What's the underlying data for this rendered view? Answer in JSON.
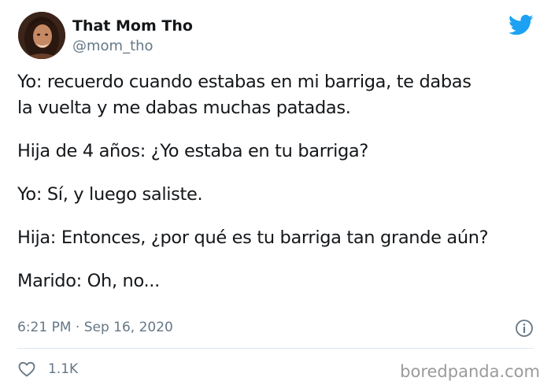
{
  "author": {
    "display_name": "That Mom Tho",
    "handle": "@mom_tho"
  },
  "icons": {
    "brand": "twitter-bird-icon",
    "info": "info-icon",
    "like": "heart-icon"
  },
  "colors": {
    "twitter_blue": "#1da1f2",
    "secondary_text": "#657786",
    "primary_text": "#14171a"
  },
  "tweet": {
    "paragraphs": [
      "Yo: recuerdo cuando estabas en mi barriga, te dabas\nla vuelta y me dabas muchas patadas.",
      "Hija de 4 años: ¿Yo estaba en tu barriga?",
      "Yo: Sí, y luego saliste.",
      "Hija: Entonces, ¿por qué es tu barriga tan grande aún?",
      "Marido: Oh, no..."
    ],
    "timestamp": "6:21 PM · Sep 16, 2020",
    "like_count": "1.1K"
  },
  "watermark": "boredpanda.com"
}
